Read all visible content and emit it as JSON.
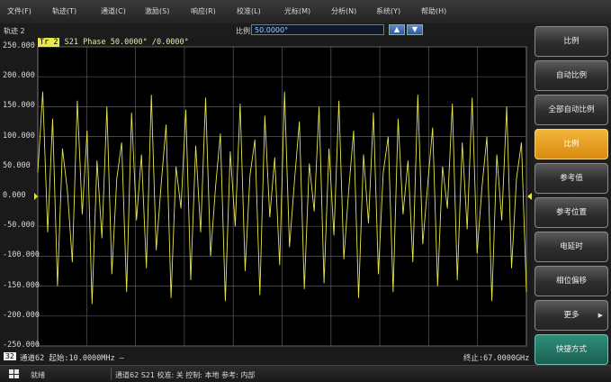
{
  "menu": [
    "文件(F)",
    "轨迹(T)",
    "通道(C)",
    "激励(S)",
    "响应(R)",
    "校准(L)",
    "光标(M)",
    "分析(N)",
    "系统(Y)",
    "帮助(H)"
  ],
  "trace_title": "轨迹 2",
  "scale": {
    "label": "比例",
    "value": "50.0000°",
    "up_icon": "arrow-up-icon",
    "down_icon": "arrow-down-icon"
  },
  "trace_header": {
    "tag": "Tr 2",
    "text": "S21 Phase 50.0000° /0.0000°"
  },
  "y_labels": [
    "250.000",
    "200.000",
    "150.000",
    "100.000",
    "50.000",
    "0.000",
    "-50.000",
    "-100.000",
    "-150.000",
    "-200.000",
    "-250.000"
  ],
  "bottom_info": {
    "channel": "32",
    "start": "通道62  起始:10.0000MHz  —",
    "stop": "终止:67.0000GHz"
  },
  "softkeys": [
    {
      "label": "比例",
      "style": "header"
    },
    {
      "label": "自动比例",
      "style": "normal"
    },
    {
      "label": "全部自动比例",
      "style": "normal"
    },
    {
      "label": "比例",
      "style": "active"
    },
    {
      "label": "参考值",
      "style": "normal"
    },
    {
      "label": "参考位置",
      "style": "normal"
    },
    {
      "label": "电延时",
      "style": "normal"
    },
    {
      "label": "相位偏移",
      "style": "normal"
    },
    {
      "label": "更多",
      "style": "normal"
    },
    {
      "label": "快捷方式",
      "style": "teal"
    }
  ],
  "status": {
    "ready": "就绪",
    "info": "通道62   S21   校准: 关   控制: 本地   参考: 内部"
  },
  "colors": {
    "trace": "#e6e64a",
    "grid": "#5a5a5a",
    "plot_bg": "#000000",
    "active_key": "#f2b53a"
  },
  "chart_data": {
    "type": "line",
    "title": "",
    "xlabel": "",
    "ylabel": "",
    "ylim": [
      -250,
      250
    ],
    "y_ticks": [
      250,
      200,
      150,
      100,
      50,
      0,
      -50,
      -100,
      -150,
      -200,
      -250
    ],
    "grid": true,
    "series": [
      {
        "values": [
          40,
          175,
          -60,
          130,
          -150,
          80,
          10,
          -110,
          160,
          -30,
          110,
          -180,
          60,
          -70,
          150,
          -130,
          30,
          90,
          -160,
          140,
          -40,
          70,
          -120,
          170,
          -90,
          20,
          120,
          -170,
          50,
          -20,
          145,
          -140,
          85,
          -60,
          165,
          -100,
          15,
          105,
          -175,
          75,
          -50,
          155,
          -125,
          35,
          95,
          -165,
          135,
          -35,
          65,
          -115,
          175,
          -85,
          25,
          125,
          -155,
          55,
          -25,
          150,
          -145,
          80,
          -65,
          160,
          -105,
          10,
          110,
          -170,
          70,
          -45,
          140,
          -130,
          40,
          100,
          -160,
          130,
          -30,
          60,
          -110,
          170,
          -80,
          20,
          115,
          -150,
          50,
          -20,
          155,
          -140,
          90,
          -55,
          165,
          -95,
          15,
          100,
          -175,
          70,
          -40,
          150,
          -120,
          30,
          90,
          -160
        ]
      }
    ]
  }
}
